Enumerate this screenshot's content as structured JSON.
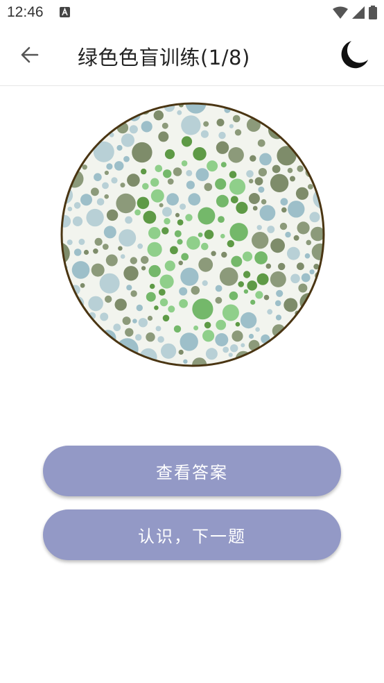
{
  "status_bar": {
    "time": "12:46",
    "notification_icon": "a-box-icon",
    "icons": [
      "wifi-icon",
      "cellular-icon",
      "battery-icon"
    ]
  },
  "app_bar": {
    "back_icon": "arrow-left-icon",
    "title": "绿色色盲训练(1/8)",
    "theme_icon": "moon-icon"
  },
  "plate": {
    "image": "color-blindness-test-plate",
    "colors": {
      "border": "#4a3512",
      "green_figure": [
        "#5e9a46",
        "#74b86a",
        "#8fcf8a"
      ],
      "background_dots": [
        "#8c9a7a",
        "#9dbfc9",
        "#b8d0d6",
        "#7e8c6a"
      ]
    }
  },
  "buttons": {
    "show_answer": "查看答案",
    "got_it_next": "认识，下一题",
    "color": "#9399c6"
  }
}
